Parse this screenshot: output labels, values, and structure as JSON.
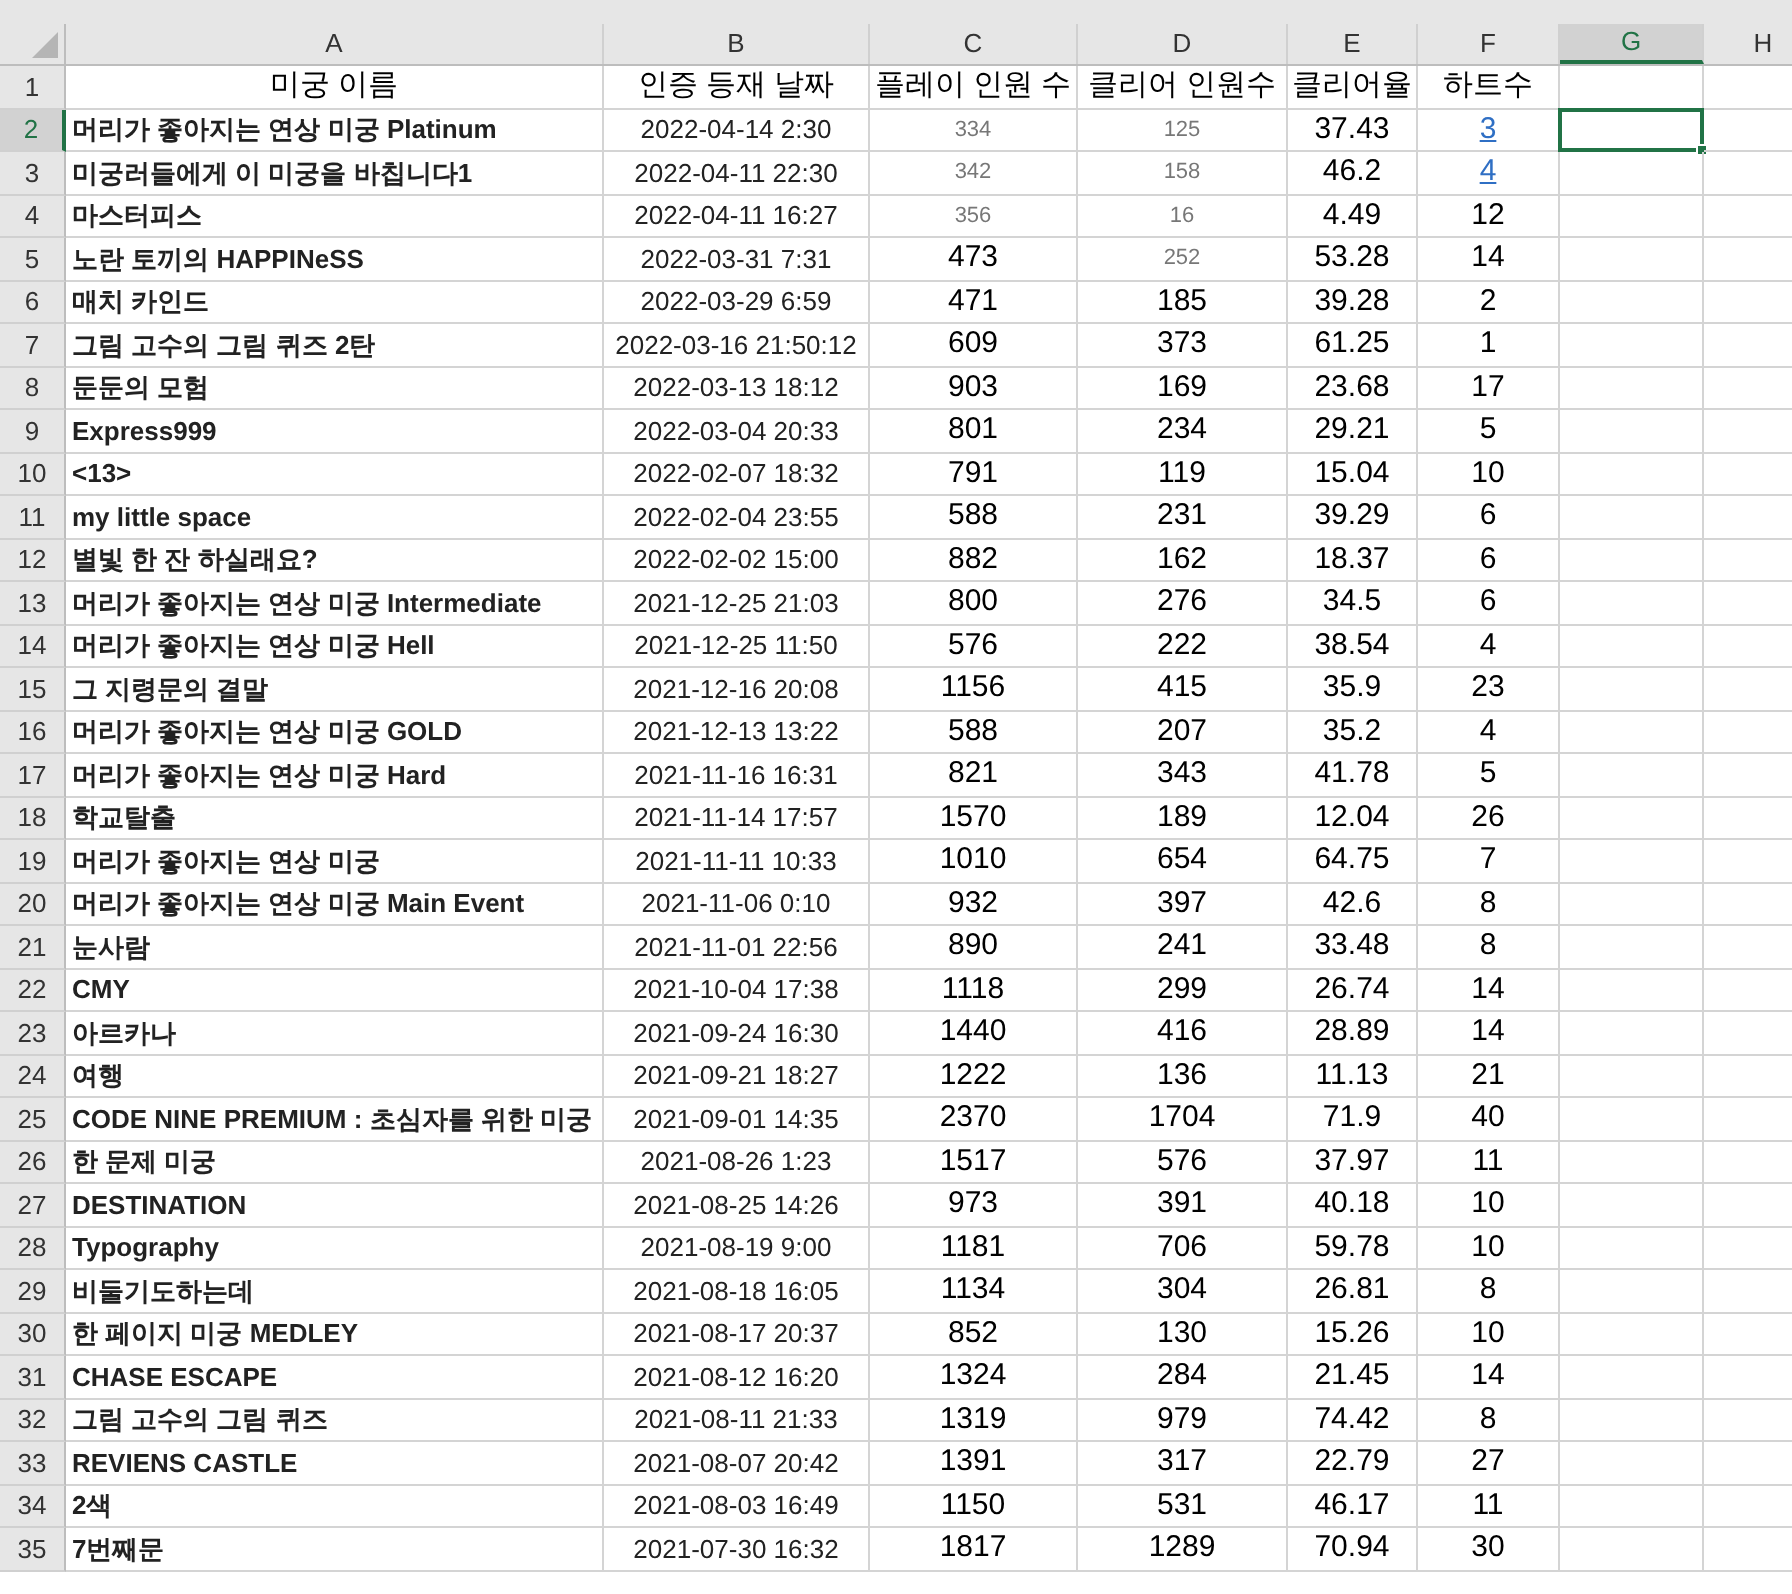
{
  "columns": [
    {
      "label": "A",
      "selected": false
    },
    {
      "label": "B",
      "selected": false
    },
    {
      "label": "C",
      "selected": false
    },
    {
      "label": "D",
      "selected": false
    },
    {
      "label": "E",
      "selected": false
    },
    {
      "label": "F",
      "selected": false
    },
    {
      "label": "G",
      "selected": true
    },
    {
      "label": "H",
      "selected": false
    }
  ],
  "rows": [
    {
      "number": "1",
      "selected": false,
      "cells": [
        {
          "text": "미궁 이름",
          "kind": "header"
        },
        {
          "text": "인증 등재 날짜",
          "kind": "header"
        },
        {
          "text": "플레이 인원 수",
          "kind": "header"
        },
        {
          "text": "클리어 인원수",
          "kind": "header"
        },
        {
          "text": "클리어율",
          "kind": "header"
        },
        {
          "text": "하트수",
          "kind": "header"
        }
      ]
    },
    {
      "number": "2",
      "selected": true,
      "cells": [
        {
          "text": "머리가 좋아지는 연상 미궁 Platinum",
          "kind": "name"
        },
        {
          "text": "2022-04-14 2:30",
          "kind": "date"
        },
        {
          "text": "334",
          "kind": "faint"
        },
        {
          "text": "125",
          "kind": "faint"
        },
        {
          "text": "37.43",
          "kind": "value"
        },
        {
          "text": "3",
          "kind": "link"
        }
      ]
    },
    {
      "number": "3",
      "selected": false,
      "cells": [
        {
          "text": "미궁러들에게 이 미궁을 바칩니다1",
          "kind": "name"
        },
        {
          "text": "2022-04-11 22:30",
          "kind": "date"
        },
        {
          "text": "342",
          "kind": "faint"
        },
        {
          "text": "158",
          "kind": "faint"
        },
        {
          "text": "46.2",
          "kind": "value"
        },
        {
          "text": "4",
          "kind": "link"
        }
      ]
    },
    {
      "number": "4",
      "selected": false,
      "cells": [
        {
          "text": "마스터피스",
          "kind": "name"
        },
        {
          "text": "2022-04-11 16:27",
          "kind": "date"
        },
        {
          "text": "356",
          "kind": "faint"
        },
        {
          "text": "16",
          "kind": "faint"
        },
        {
          "text": "4.49",
          "kind": "value"
        },
        {
          "text": "12",
          "kind": "value"
        }
      ]
    },
    {
      "number": "5",
      "selected": false,
      "cells": [
        {
          "text": "노란 토끼의 HAPPINeSS",
          "kind": "name"
        },
        {
          "text": "2022-03-31 7:31",
          "kind": "date"
        },
        {
          "text": "473",
          "kind": "value"
        },
        {
          "text": "252",
          "kind": "faint"
        },
        {
          "text": "53.28",
          "kind": "value"
        },
        {
          "text": "14",
          "kind": "value"
        }
      ]
    },
    {
      "number": "6",
      "selected": false,
      "cells": [
        {
          "text": "매치 카인드",
          "kind": "name"
        },
        {
          "text": "2022-03-29 6:59",
          "kind": "date"
        },
        {
          "text": "471",
          "kind": "value"
        },
        {
          "text": "185",
          "kind": "value"
        },
        {
          "text": "39.28",
          "kind": "value"
        },
        {
          "text": "2",
          "kind": "value"
        }
      ]
    },
    {
      "number": "7",
      "selected": false,
      "cells": [
        {
          "text": "그림 고수의 그림 퀴즈 2탄",
          "kind": "name"
        },
        {
          "text": "2022-03-16 21:50:12",
          "kind": "date"
        },
        {
          "text": "609",
          "kind": "value"
        },
        {
          "text": "373",
          "kind": "value"
        },
        {
          "text": "61.25",
          "kind": "value"
        },
        {
          "text": "1",
          "kind": "value"
        }
      ]
    },
    {
      "number": "8",
      "selected": false,
      "cells": [
        {
          "text": "둔둔의 모험",
          "kind": "name"
        },
        {
          "text": "2022-03-13 18:12",
          "kind": "date"
        },
        {
          "text": "903",
          "kind": "value"
        },
        {
          "text": "169",
          "kind": "value"
        },
        {
          "text": "23.68",
          "kind": "value"
        },
        {
          "text": "17",
          "kind": "value"
        }
      ]
    },
    {
      "number": "9",
      "selected": false,
      "cells": [
        {
          "text": "Express999",
          "kind": "name"
        },
        {
          "text": "2022-03-04 20:33",
          "kind": "date"
        },
        {
          "text": "801",
          "kind": "value"
        },
        {
          "text": "234",
          "kind": "value"
        },
        {
          "text": "29.21",
          "kind": "value"
        },
        {
          "text": "5",
          "kind": "value"
        }
      ]
    },
    {
      "number": "10",
      "selected": false,
      "cells": [
        {
          "text": "<13>",
          "kind": "name"
        },
        {
          "text": "2022-02-07 18:32",
          "kind": "date"
        },
        {
          "text": "791",
          "kind": "value"
        },
        {
          "text": "119",
          "kind": "value"
        },
        {
          "text": "15.04",
          "kind": "value"
        },
        {
          "text": "10",
          "kind": "value"
        }
      ]
    },
    {
      "number": "11",
      "selected": false,
      "cells": [
        {
          "text": "my little space",
          "kind": "name"
        },
        {
          "text": "2022-02-04 23:55",
          "kind": "date"
        },
        {
          "text": "588",
          "kind": "value"
        },
        {
          "text": "231",
          "kind": "value"
        },
        {
          "text": "39.29",
          "kind": "value"
        },
        {
          "text": "6",
          "kind": "value"
        }
      ]
    },
    {
      "number": "12",
      "selected": false,
      "cells": [
        {
          "text": "별빛 한 잔 하실래요?",
          "kind": "name"
        },
        {
          "text": "2022-02-02 15:00",
          "kind": "date"
        },
        {
          "text": "882",
          "kind": "value"
        },
        {
          "text": "162",
          "kind": "value"
        },
        {
          "text": "18.37",
          "kind": "value"
        },
        {
          "text": "6",
          "kind": "value"
        }
      ]
    },
    {
      "number": "13",
      "selected": false,
      "cells": [
        {
          "text": "머리가 좋아지는 연상 미궁 Intermediate",
          "kind": "name"
        },
        {
          "text": "2021-12-25 21:03",
          "kind": "date"
        },
        {
          "text": "800",
          "kind": "value"
        },
        {
          "text": "276",
          "kind": "value"
        },
        {
          "text": "34.5",
          "kind": "value"
        },
        {
          "text": "6",
          "kind": "value"
        }
      ]
    },
    {
      "number": "14",
      "selected": false,
      "cells": [
        {
          "text": "머리가 좋아지는 연상 미궁 Hell",
          "kind": "name"
        },
        {
          "text": "2021-12-25 11:50",
          "kind": "date"
        },
        {
          "text": "576",
          "kind": "value"
        },
        {
          "text": "222",
          "kind": "value"
        },
        {
          "text": "38.54",
          "kind": "value"
        },
        {
          "text": "4",
          "kind": "value"
        }
      ]
    },
    {
      "number": "15",
      "selected": false,
      "cells": [
        {
          "text": "그 지령문의 결말",
          "kind": "name"
        },
        {
          "text": "2021-12-16 20:08",
          "kind": "date"
        },
        {
          "text": "1156",
          "kind": "value"
        },
        {
          "text": "415",
          "kind": "value"
        },
        {
          "text": "35.9",
          "kind": "value"
        },
        {
          "text": "23",
          "kind": "value"
        }
      ]
    },
    {
      "number": "16",
      "selected": false,
      "cells": [
        {
          "text": "머리가 좋아지는 연상 미궁 GOLD",
          "kind": "name"
        },
        {
          "text": "2021-12-13 13:22",
          "kind": "date"
        },
        {
          "text": "588",
          "kind": "value"
        },
        {
          "text": "207",
          "kind": "value"
        },
        {
          "text": "35.2",
          "kind": "value"
        },
        {
          "text": "4",
          "kind": "value"
        }
      ]
    },
    {
      "number": "17",
      "selected": false,
      "cells": [
        {
          "text": "머리가 좋아지는 연상 미궁 Hard",
          "kind": "name"
        },
        {
          "text": "2021-11-16 16:31",
          "kind": "date"
        },
        {
          "text": "821",
          "kind": "value"
        },
        {
          "text": "343",
          "kind": "value"
        },
        {
          "text": "41.78",
          "kind": "value"
        },
        {
          "text": "5",
          "kind": "value"
        }
      ]
    },
    {
      "number": "18",
      "selected": false,
      "cells": [
        {
          "text": "학교탈출",
          "kind": "name"
        },
        {
          "text": "2021-11-14 17:57",
          "kind": "date"
        },
        {
          "text": "1570",
          "kind": "value"
        },
        {
          "text": "189",
          "kind": "value"
        },
        {
          "text": "12.04",
          "kind": "value"
        },
        {
          "text": "26",
          "kind": "value"
        }
      ]
    },
    {
      "number": "19",
      "selected": false,
      "cells": [
        {
          "text": "머리가 좋아지는 연상 미궁",
          "kind": "name"
        },
        {
          "text": "2021-11-11 10:33",
          "kind": "date"
        },
        {
          "text": "1010",
          "kind": "value"
        },
        {
          "text": "654",
          "kind": "value"
        },
        {
          "text": "64.75",
          "kind": "value"
        },
        {
          "text": "7",
          "kind": "value"
        }
      ]
    },
    {
      "number": "20",
      "selected": false,
      "cells": [
        {
          "text": "머리가 좋아지는 연상 미궁 Main Event",
          "kind": "name"
        },
        {
          "text": "2021-11-06 0:10",
          "kind": "date"
        },
        {
          "text": "932",
          "kind": "value"
        },
        {
          "text": "397",
          "kind": "value"
        },
        {
          "text": "42.6",
          "kind": "value"
        },
        {
          "text": "8",
          "kind": "value"
        }
      ]
    },
    {
      "number": "21",
      "selected": false,
      "cells": [
        {
          "text": "눈사람",
          "kind": "name"
        },
        {
          "text": "2021-11-01 22:56",
          "kind": "date"
        },
        {
          "text": "890",
          "kind": "value"
        },
        {
          "text": "241",
          "kind": "value"
        },
        {
          "text": "33.48",
          "kind": "value"
        },
        {
          "text": "8",
          "kind": "value"
        }
      ]
    },
    {
      "number": "22",
      "selected": false,
      "cells": [
        {
          "text": "CMY",
          "kind": "name"
        },
        {
          "text": "2021-10-04 17:38",
          "kind": "date"
        },
        {
          "text": "1118",
          "kind": "value"
        },
        {
          "text": "299",
          "kind": "value"
        },
        {
          "text": "26.74",
          "kind": "value"
        },
        {
          "text": "14",
          "kind": "value"
        }
      ]
    },
    {
      "number": "23",
      "selected": false,
      "cells": [
        {
          "text": "아르카나",
          "kind": "name"
        },
        {
          "text": "2021-09-24 16:30",
          "kind": "date"
        },
        {
          "text": "1440",
          "kind": "value"
        },
        {
          "text": "416",
          "kind": "value"
        },
        {
          "text": "28.89",
          "kind": "value"
        },
        {
          "text": "14",
          "kind": "value"
        }
      ]
    },
    {
      "number": "24",
      "selected": false,
      "cells": [
        {
          "text": "여행",
          "kind": "name"
        },
        {
          "text": "2021-09-21 18:27",
          "kind": "date"
        },
        {
          "text": "1222",
          "kind": "value"
        },
        {
          "text": "136",
          "kind": "value"
        },
        {
          "text": "11.13",
          "kind": "value"
        },
        {
          "text": "21",
          "kind": "value"
        }
      ]
    },
    {
      "number": "25",
      "selected": false,
      "cells": [
        {
          "text": "CODE NINE PREMIUM : 초심자를 위한 미궁",
          "kind": "name"
        },
        {
          "text": "2021-09-01 14:35",
          "kind": "date"
        },
        {
          "text": "2370",
          "kind": "value"
        },
        {
          "text": "1704",
          "kind": "value"
        },
        {
          "text": "71.9",
          "kind": "value"
        },
        {
          "text": "40",
          "kind": "value"
        }
      ]
    },
    {
      "number": "26",
      "selected": false,
      "cells": [
        {
          "text": "한 문제 미궁",
          "kind": "name"
        },
        {
          "text": "2021-08-26 1:23",
          "kind": "date"
        },
        {
          "text": "1517",
          "kind": "value"
        },
        {
          "text": "576",
          "kind": "value"
        },
        {
          "text": "37.97",
          "kind": "value"
        },
        {
          "text": "11",
          "kind": "value"
        }
      ]
    },
    {
      "number": "27",
      "selected": false,
      "cells": [
        {
          "text": "DESTINATION",
          "kind": "name"
        },
        {
          "text": "2021-08-25 14:26",
          "kind": "date"
        },
        {
          "text": "973",
          "kind": "value"
        },
        {
          "text": "391",
          "kind": "value"
        },
        {
          "text": "40.18",
          "kind": "value"
        },
        {
          "text": "10",
          "kind": "value"
        }
      ]
    },
    {
      "number": "28",
      "selected": false,
      "cells": [
        {
          "text": "Typography",
          "kind": "name"
        },
        {
          "text": "2021-08-19 9:00",
          "kind": "date"
        },
        {
          "text": "1181",
          "kind": "value"
        },
        {
          "text": "706",
          "kind": "value"
        },
        {
          "text": "59.78",
          "kind": "value"
        },
        {
          "text": "10",
          "kind": "value"
        }
      ]
    },
    {
      "number": "29",
      "selected": false,
      "cells": [
        {
          "text": "비둘기도하는데",
          "kind": "name"
        },
        {
          "text": "2021-08-18 16:05",
          "kind": "date"
        },
        {
          "text": "1134",
          "kind": "value"
        },
        {
          "text": "304",
          "kind": "value"
        },
        {
          "text": "26.81",
          "kind": "value"
        },
        {
          "text": "8",
          "kind": "value"
        }
      ]
    },
    {
      "number": "30",
      "selected": false,
      "cells": [
        {
          "text": "한 페이지 미궁 MEDLEY",
          "kind": "name"
        },
        {
          "text": "2021-08-17 20:37",
          "kind": "date"
        },
        {
          "text": "852",
          "kind": "value"
        },
        {
          "text": "130",
          "kind": "value"
        },
        {
          "text": "15.26",
          "kind": "value"
        },
        {
          "text": "10",
          "kind": "value"
        }
      ]
    },
    {
      "number": "31",
      "selected": false,
      "cells": [
        {
          "text": "CHASE ESCAPE",
          "kind": "name"
        },
        {
          "text": "2021-08-12 16:20",
          "kind": "date"
        },
        {
          "text": "1324",
          "kind": "value"
        },
        {
          "text": "284",
          "kind": "value"
        },
        {
          "text": "21.45",
          "kind": "value"
        },
        {
          "text": "14",
          "kind": "value"
        }
      ]
    },
    {
      "number": "32",
      "selected": false,
      "cells": [
        {
          "text": "그림 고수의 그림 퀴즈",
          "kind": "name"
        },
        {
          "text": "2021-08-11 21:33",
          "kind": "date"
        },
        {
          "text": "1319",
          "kind": "value"
        },
        {
          "text": "979",
          "kind": "value"
        },
        {
          "text": "74.42",
          "kind": "value"
        },
        {
          "text": "8",
          "kind": "value"
        }
      ]
    },
    {
      "number": "33",
      "selected": false,
      "cells": [
        {
          "text": "REVIENS CASTLE",
          "kind": "name"
        },
        {
          "text": "2021-08-07 20:42",
          "kind": "date"
        },
        {
          "text": "1391",
          "kind": "value"
        },
        {
          "text": "317",
          "kind": "value"
        },
        {
          "text": "22.79",
          "kind": "value"
        },
        {
          "text": "27",
          "kind": "value"
        }
      ]
    },
    {
      "number": "34",
      "selected": false,
      "cells": [
        {
          "text": "2색",
          "kind": "name"
        },
        {
          "text": "2021-08-03 16:49",
          "kind": "date"
        },
        {
          "text": "1150",
          "kind": "value"
        },
        {
          "text": "531",
          "kind": "value"
        },
        {
          "text": "46.17",
          "kind": "value"
        },
        {
          "text": "11",
          "kind": "value"
        }
      ]
    },
    {
      "number": "35",
      "selected": false,
      "cells": [
        {
          "text": "7번째문",
          "kind": "name"
        },
        {
          "text": "2021-07-30 16:32",
          "kind": "date"
        },
        {
          "text": "1817",
          "kind": "value"
        },
        {
          "text": "1289",
          "kind": "value"
        },
        {
          "text": "70.94",
          "kind": "value"
        },
        {
          "text": "30",
          "kind": "value"
        }
      ]
    }
  ]
}
